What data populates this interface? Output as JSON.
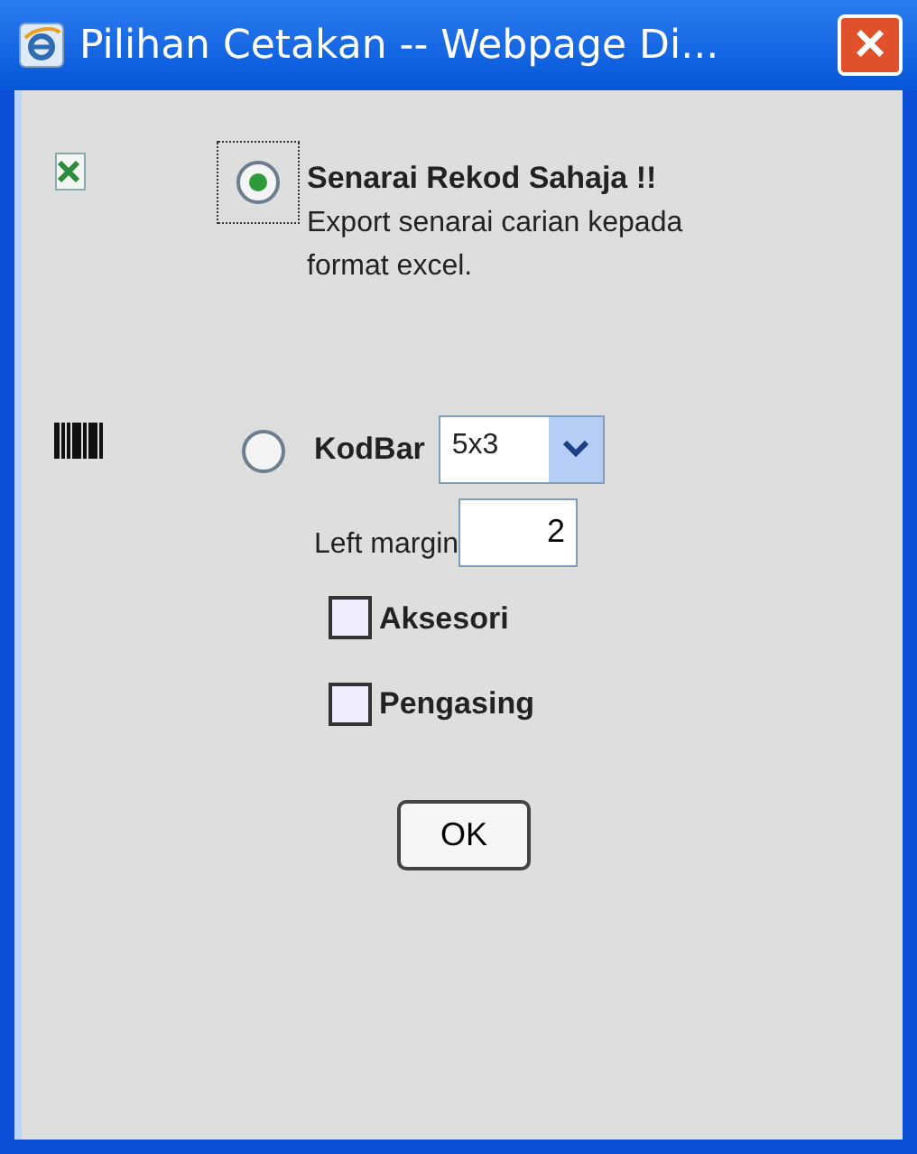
{
  "window": {
    "title": "Pilihan Cetakan -- Webpage Di...",
    "close": "×"
  },
  "options": [
    {
      "kind": "excel",
      "selected": true,
      "title": "Senarai Rekod Sahaja !!",
      "description": "Export senarai carian kepada format excel."
    },
    {
      "kind": "barcode",
      "selected": false,
      "title": "KodBar",
      "size": {
        "value": "5x3"
      },
      "left_margin": {
        "label": "Left margin",
        "value": "2"
      },
      "checkboxes": [
        {
          "label": "Aksesori",
          "checked": false
        },
        {
          "label": "Pengasing",
          "checked": false
        }
      ]
    }
  ],
  "buttons": [
    "OK"
  ]
}
